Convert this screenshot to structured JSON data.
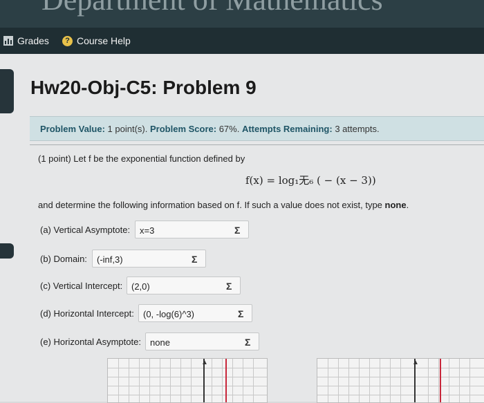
{
  "header": {
    "department_title": "Department of Mathematics"
  },
  "nav": {
    "grades_label": "Grades",
    "course_help_label": "Course Help",
    "grades_icon": "bar-chart-icon",
    "help_icon": "question-circle-icon"
  },
  "problem": {
    "title": "Hw20-Obj-C5: Problem 9",
    "info": {
      "value_label": "Problem Value:",
      "value_text": "1 point(s).",
      "score_label": "Problem Score:",
      "score_text": "67%.",
      "attempts_label": "Attempts Remaining:",
      "attempts_text": "3 attempts."
    },
    "intro": "(1 point) Let f be the exponential function defined by",
    "formula": "f(x) = log₁⽆₆ ( − (x − 3))",
    "instruction_start": "and determine the following information based on f. If such a value does not exist, type ",
    "instruction_bold": "none",
    "instruction_end": "."
  },
  "fields": [
    {
      "label": "(a) Vertical Asymptote:",
      "value": "x=3"
    },
    {
      "label": "(b) Domain:",
      "value": "(-inf,3)"
    },
    {
      "label": "(c) Vertical Intercept:",
      "value": "(2,0)"
    },
    {
      "label": "(d) Horizontal Intercept:",
      "value": "(0, -log(6)^3)"
    },
    {
      "label": "(e) Horizontal Asymptote:",
      "value": "none"
    }
  ],
  "sigma_symbol": "Σ",
  "colors": {
    "banner": "#2c3f45",
    "nav": "#1f2e33",
    "info_bg": "#cfe0e3",
    "asymptote": "#c8263a"
  }
}
